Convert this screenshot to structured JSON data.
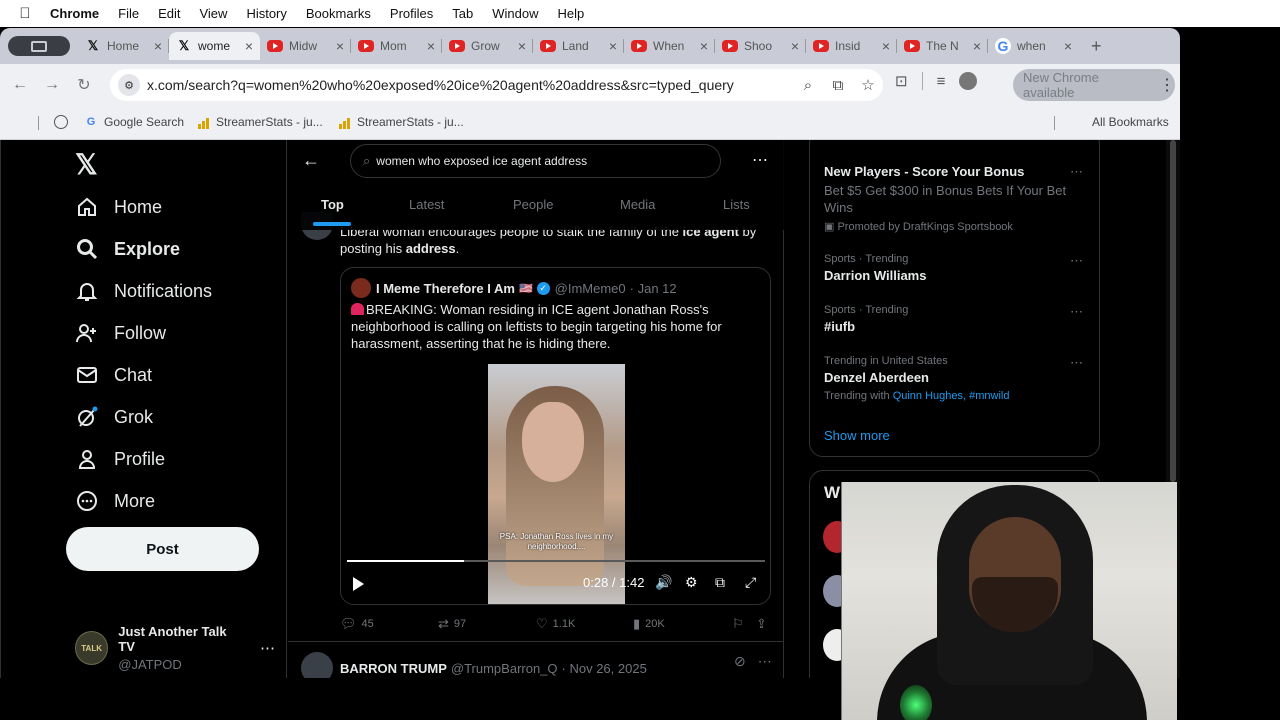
{
  "menubar": {
    "app": "Chrome",
    "items": [
      "File",
      "Edit",
      "View",
      "History",
      "Bookmarks",
      "Profiles",
      "Tab",
      "Window",
      "Help"
    ]
  },
  "tabs": [
    {
      "icon": "x",
      "title": "Home"
    },
    {
      "icon": "x",
      "title": "wome",
      "active": true
    },
    {
      "icon": "youtube",
      "title": "Midw"
    },
    {
      "icon": "youtube",
      "title": "Mom"
    },
    {
      "icon": "youtube",
      "title": "Grow"
    },
    {
      "icon": "youtube",
      "title": "Land"
    },
    {
      "icon": "youtube",
      "title": "When"
    },
    {
      "icon": "youtube",
      "title": "Shoo"
    },
    {
      "icon": "youtube",
      "title": "Insid"
    },
    {
      "icon": "youtube",
      "title": "The N"
    },
    {
      "icon": "google",
      "title": "when"
    }
  ],
  "toolbar": {
    "url": "x.com/search?q=women%20who%20exposed%20ice%20agent%20address&src=typed_query",
    "update_label": "New Chrome available"
  },
  "bookmarks": {
    "items": [
      "Google Search",
      "StreamerStats - ju...",
      "StreamerStats - ju..."
    ],
    "all_label": "All Bookmarks"
  },
  "nav": {
    "items": [
      "Home",
      "Explore",
      "Notifications",
      "Follow",
      "Chat",
      "Grok",
      "Profile",
      "More"
    ],
    "post_label": "Post",
    "account_name": "Just Another Talk TV",
    "account_handle": "@JATPOD",
    "account_badge": "TALK"
  },
  "search": {
    "query": "women who exposed ice agent address",
    "tabs": [
      "Top",
      "Latest",
      "People",
      "Media",
      "Lists"
    ]
  },
  "tweet": {
    "text_pre": "Liberal woman encourages people to stalk the family of the ",
    "text_bold1": "ice agent",
    "text_mid": " by posting his ",
    "text_bold2": "address",
    "text_post": ".",
    "quote": {
      "name": "I Meme Therefore I Am",
      "flag": "🇺🇸",
      "handle": "@ImMeme0",
      "date": "· Jan 12",
      "text": "BREAKING: Woman residing in ICE agent Jonathan Ross's neighborhood is calling on leftists to begin targeting his home for harassment, asserting that he is hiding there.",
      "video_caption": "PSA: Jonathan Ross lives in my neighborhood....",
      "video_time": "0:28 / 1:42",
      "progress": 0.28
    },
    "stats": {
      "replies": "45",
      "reposts": "97",
      "likes": "1.1K",
      "views": "20K"
    }
  },
  "tweet2": {
    "name": "BARRON TRUMP",
    "handle": "@TrumpBarron_Q",
    "date": "· Nov 26, 2025"
  },
  "sidebar": {
    "promo": {
      "title": "New Players - Score Your Bonus",
      "desc": "Bet $5 Get $300 in Bonus Bets If Your Bet Wins",
      "by": "Promoted by DraftKings Sportsbook"
    },
    "trends": [
      {
        "category": "Sports · Trending",
        "name": "Darrion Williams"
      },
      {
        "category": "Sports · Trending",
        "name": "#iufb"
      },
      {
        "category": "Trending in United States",
        "name": "Denzel Aberdeen",
        "with_label": "Trending with",
        "with": "Quinn Hughes, #mnwild"
      }
    ],
    "show_more": "Show more",
    "wtf_title": "Wh"
  }
}
